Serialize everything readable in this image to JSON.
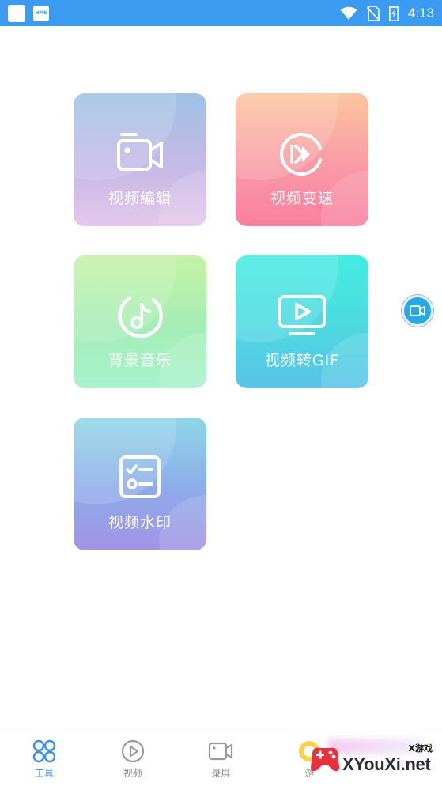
{
  "status_bar": {
    "time": "4:13",
    "left_icons": [
      "notification-square-icon",
      "hms-icon"
    ],
    "hms_text": "HMS",
    "right_icons": [
      "wifi-icon",
      "no-sim-icon",
      "battery-charging-icon"
    ],
    "background": "#3a9bf0"
  },
  "tools": [
    {
      "id": "edit",
      "label": "视频编辑",
      "icon": "video-camera-icon"
    },
    {
      "id": "speed",
      "label": "视频变速",
      "icon": "fast-forward-circle-icon"
    },
    {
      "id": "music",
      "label": "背景音乐",
      "icon": "music-note-circle-icon"
    },
    {
      "id": "gif",
      "label": "视频转GIF",
      "icon": "monitor-play-icon"
    },
    {
      "id": "watermark",
      "label": "视频水印",
      "icon": "checklist-icon"
    }
  ],
  "floating_button": {
    "icon": "screen-record-icon"
  },
  "bottom_nav": {
    "items": [
      {
        "label": "工具",
        "icon": "tools-grid-icon",
        "active": true
      },
      {
        "label": "视频",
        "icon": "play-circle-icon",
        "active": false
      },
      {
        "label": "录屏",
        "icon": "record-camera-icon",
        "active": false
      },
      {
        "label": "游",
        "icon": "games-icon",
        "active": false
      }
    ],
    "active_color": "#3a8ff0",
    "inactive_color": "#8a8a8a"
  },
  "watermark": {
    "top": "X游戏",
    "main": "XYouXi.net"
  }
}
